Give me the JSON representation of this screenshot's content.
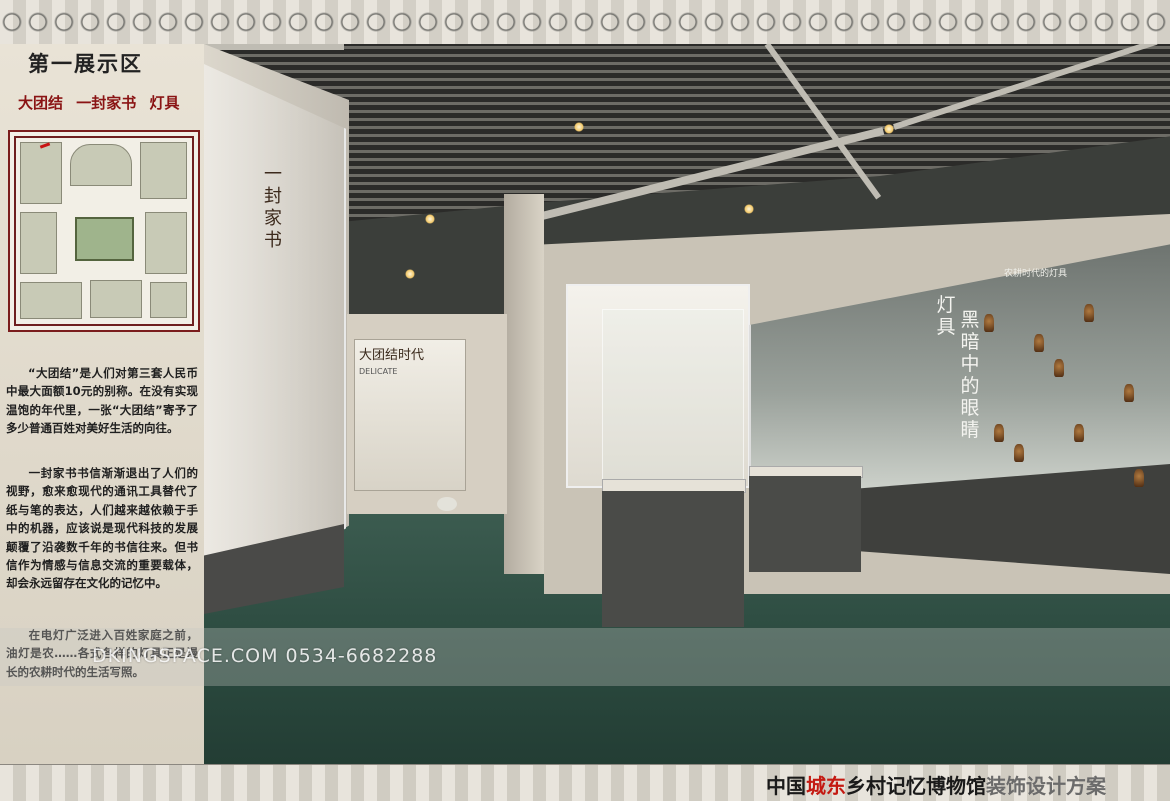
{
  "zone_title": "第一展示区",
  "topics": [
    "大团结",
    "一封家书",
    "灯具"
  ],
  "paragraphs": [
    "“大团结”是人们对第三套人民币中最大面额10元的别称。在没有实现温饱的年代里，一张“大团结”寄予了多少普通百姓对美好生活的向往。",
    "一封家书书信渐渐退出了人们的视野，愈来愈现代的通讯工具替代了纸与笔的表达，人们越来越依赖于手中的机器，应该说是现代科技的发展颠覆了沿袭数千年的书信往来。但书信作为情感与信息交流的重要载体，却会永远留存在文化的记忆中。",
    "在电灯广泛进入百姓家庭之前，油灯是农……各式各样的灯具正是漫长的农耕时代的生活写照。"
  ],
  "scene": {
    "left_case_label": "一封家书",
    "mid_panel_label": "大团结时代",
    "mid_panel_tag": "DELICATE",
    "right_case_title": "灯具",
    "right_case_subtitle": "黑暗中的眼睛",
    "right_case_caption": "农耕时代的灯具"
  },
  "watermark": "DKINGSPACE.COM  0534-6682288",
  "bottom_title": {
    "part1": "中国",
    "part2": "城东",
    "part3": "乡村记忆博物馆",
    "part4": "装饰设计方案"
  },
  "colors": {
    "accent_red": "#c41a12",
    "topic_red": "#8a1414",
    "floor_green": "#2b4a3f"
  }
}
